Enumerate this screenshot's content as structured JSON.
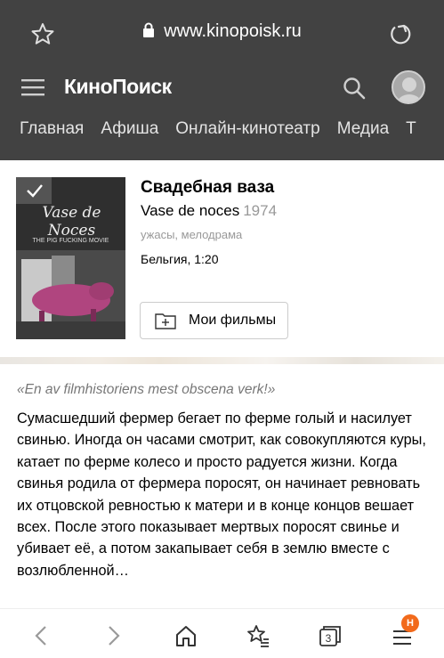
{
  "browser": {
    "url": "www.kinopoisk.ru",
    "icons": [
      "star-icon",
      "lock-icon",
      "reload-icon"
    ]
  },
  "header": {
    "logo": "КиноПоиск",
    "nav": [
      "Главная",
      "Афиша",
      "Онлайн-кинотеатр",
      "Медиа",
      "Т"
    ]
  },
  "film": {
    "title": "Свадебная ваза",
    "original_title": "Vase de noces",
    "year": "1974",
    "genres": "ужасы, мелодрама",
    "meta": "Бельгия, 1:20",
    "my_films_button": "Мои фильмы",
    "poster": {
      "title": "Vase de Noces",
      "tagline": "THE PIG FUCKING MOVIE"
    }
  },
  "review": {
    "quote": "«En av filmhistoriens mest obscena verk!»",
    "text": "Сумасшедший фермер бегает по ферме голый и насилует свинью. Иногда он часами смотрит, как совокупляются куры, катает по ферме колесо и просто радуется жизни. Когда свинья родила от фермера поросят, он начинает ревновать их отцовской ревностью к матери и в конце концов вешает всех. После этого показывает мертвых поросят свинье и убивает её, а потом закапывает себя в землю вместе с возлюбленной…"
  },
  "toolbar": {
    "tabs_count": "3",
    "menu_badge": "Н"
  },
  "colors": {
    "header_bg": "#424242",
    "badge": "#f26a1b"
  }
}
